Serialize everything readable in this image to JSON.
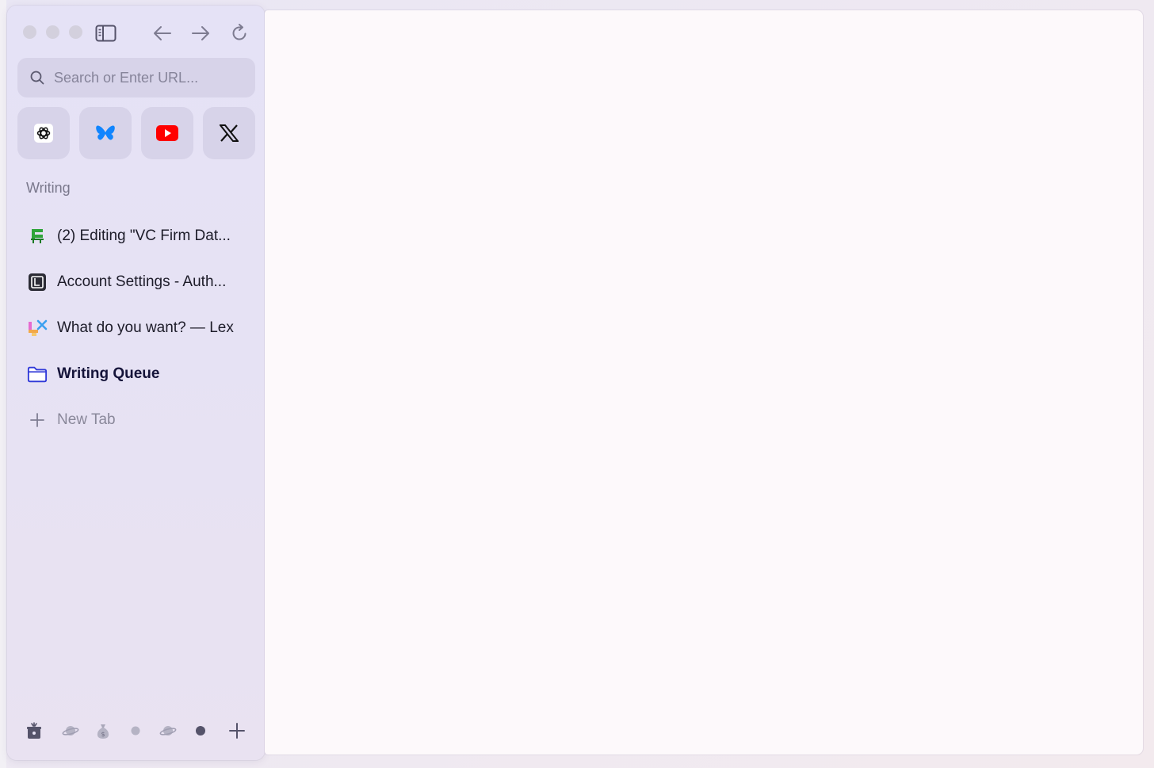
{
  "window": {
    "traffic_lights": [
      "close",
      "minimize",
      "zoom"
    ],
    "colors": {
      "sidebar": "#e5e2f6",
      "content": "#fdf9fb",
      "folder_accent": "#2f38d8"
    }
  },
  "toolbar": {
    "buttons": [
      "sidebar-toggle-icon",
      "back-arrow-icon",
      "forward-arrow-icon",
      "reload-icon"
    ]
  },
  "search": {
    "placeholder": "Search or Enter URL..."
  },
  "favorites": [
    {
      "name": "chatgpt",
      "icon": "openai-logo-icon"
    },
    {
      "name": "bluesky",
      "icon": "butterfly-icon"
    },
    {
      "name": "youtube",
      "icon": "youtube-play-icon"
    },
    {
      "name": "x",
      "icon": "x-logo-icon"
    }
  ],
  "section": {
    "label": "Writing"
  },
  "tabs": [
    {
      "label": "(2) Editing \"VC Firm Dat...",
      "icon": "green-site-icon"
    },
    {
      "label": "Account Settings - Auth...",
      "icon": "dark-app-icon"
    },
    {
      "label": "What do you want? — Lex",
      "icon": "lex-logo-icon"
    },
    {
      "label": "Writing Queue",
      "icon": "folder-icon"
    },
    {
      "label": "New Tab",
      "icon": "plus-icon"
    }
  ],
  "bottom_bar": {
    "items": [
      "downloads-icon",
      "planet-icon",
      "money-bag-icon",
      "dot-icon",
      "planet-icon",
      "dot-icon",
      "add-space-icon"
    ]
  }
}
